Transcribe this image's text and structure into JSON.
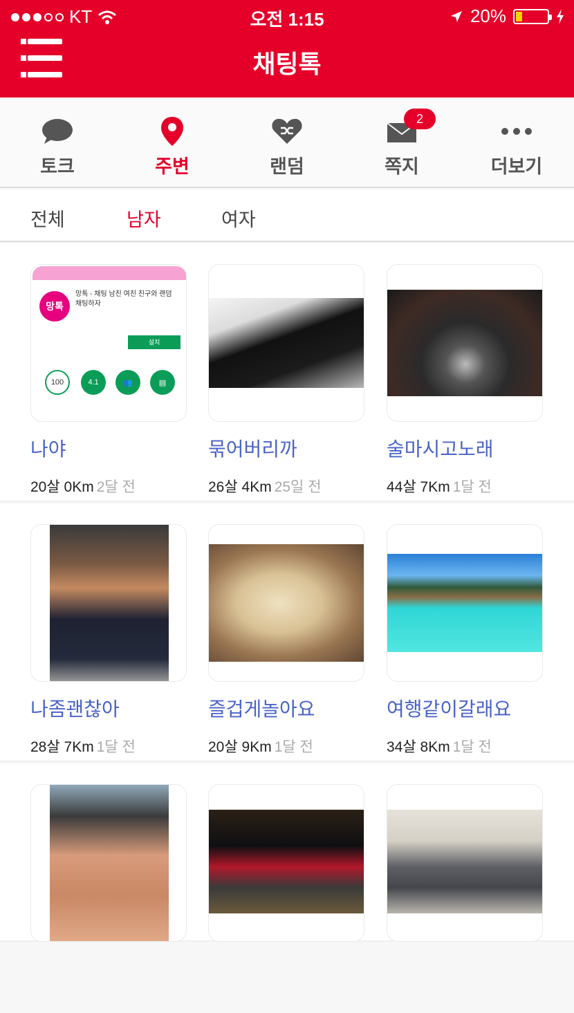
{
  "status": {
    "carrier": "KT",
    "time": "오전 1:15",
    "battery": "20%"
  },
  "header": {
    "title": "채팅톡"
  },
  "tabs": [
    {
      "label": "토크",
      "icon": "chat-bubble-icon"
    },
    {
      "label": "주변",
      "icon": "location-pin-icon"
    },
    {
      "label": "랜덤",
      "icon": "shuffle-heart-icon"
    },
    {
      "label": "쪽지",
      "icon": "envelope-icon",
      "badge": "2"
    },
    {
      "label": "더보기",
      "icon": "more-dots-icon"
    }
  ],
  "filters": [
    "전체",
    "남자",
    "여자"
  ],
  "colors": {
    "brand": "#e5002a",
    "name": "#4a63c8"
  },
  "users": [
    {
      "name": "나야",
      "info": "20살 0Km",
      "ago": "2달 전"
    },
    {
      "name": "묶어버리까",
      "info": "26살 4Km",
      "ago": "25일 전"
    },
    {
      "name": "술마시고노래",
      "info": "44살 7Km",
      "ago": "1달 전"
    },
    {
      "name": "나좀괜찮아",
      "info": "28살 7Km",
      "ago": "1달 전"
    },
    {
      "name": "즐겁게놀아요",
      "info": "20살 9Km",
      "ago": "1달 전"
    },
    {
      "name": "여행같이갈래요",
      "info": "34살 8Km",
      "ago": "1달 전"
    }
  ],
  "app_shot": {
    "logo": "망톡",
    "text": "망톡 - 채팅 남친 여친 친구와 랜덤채팅하자",
    "install": "설치",
    "stat": "100",
    "rating": "4.1"
  }
}
